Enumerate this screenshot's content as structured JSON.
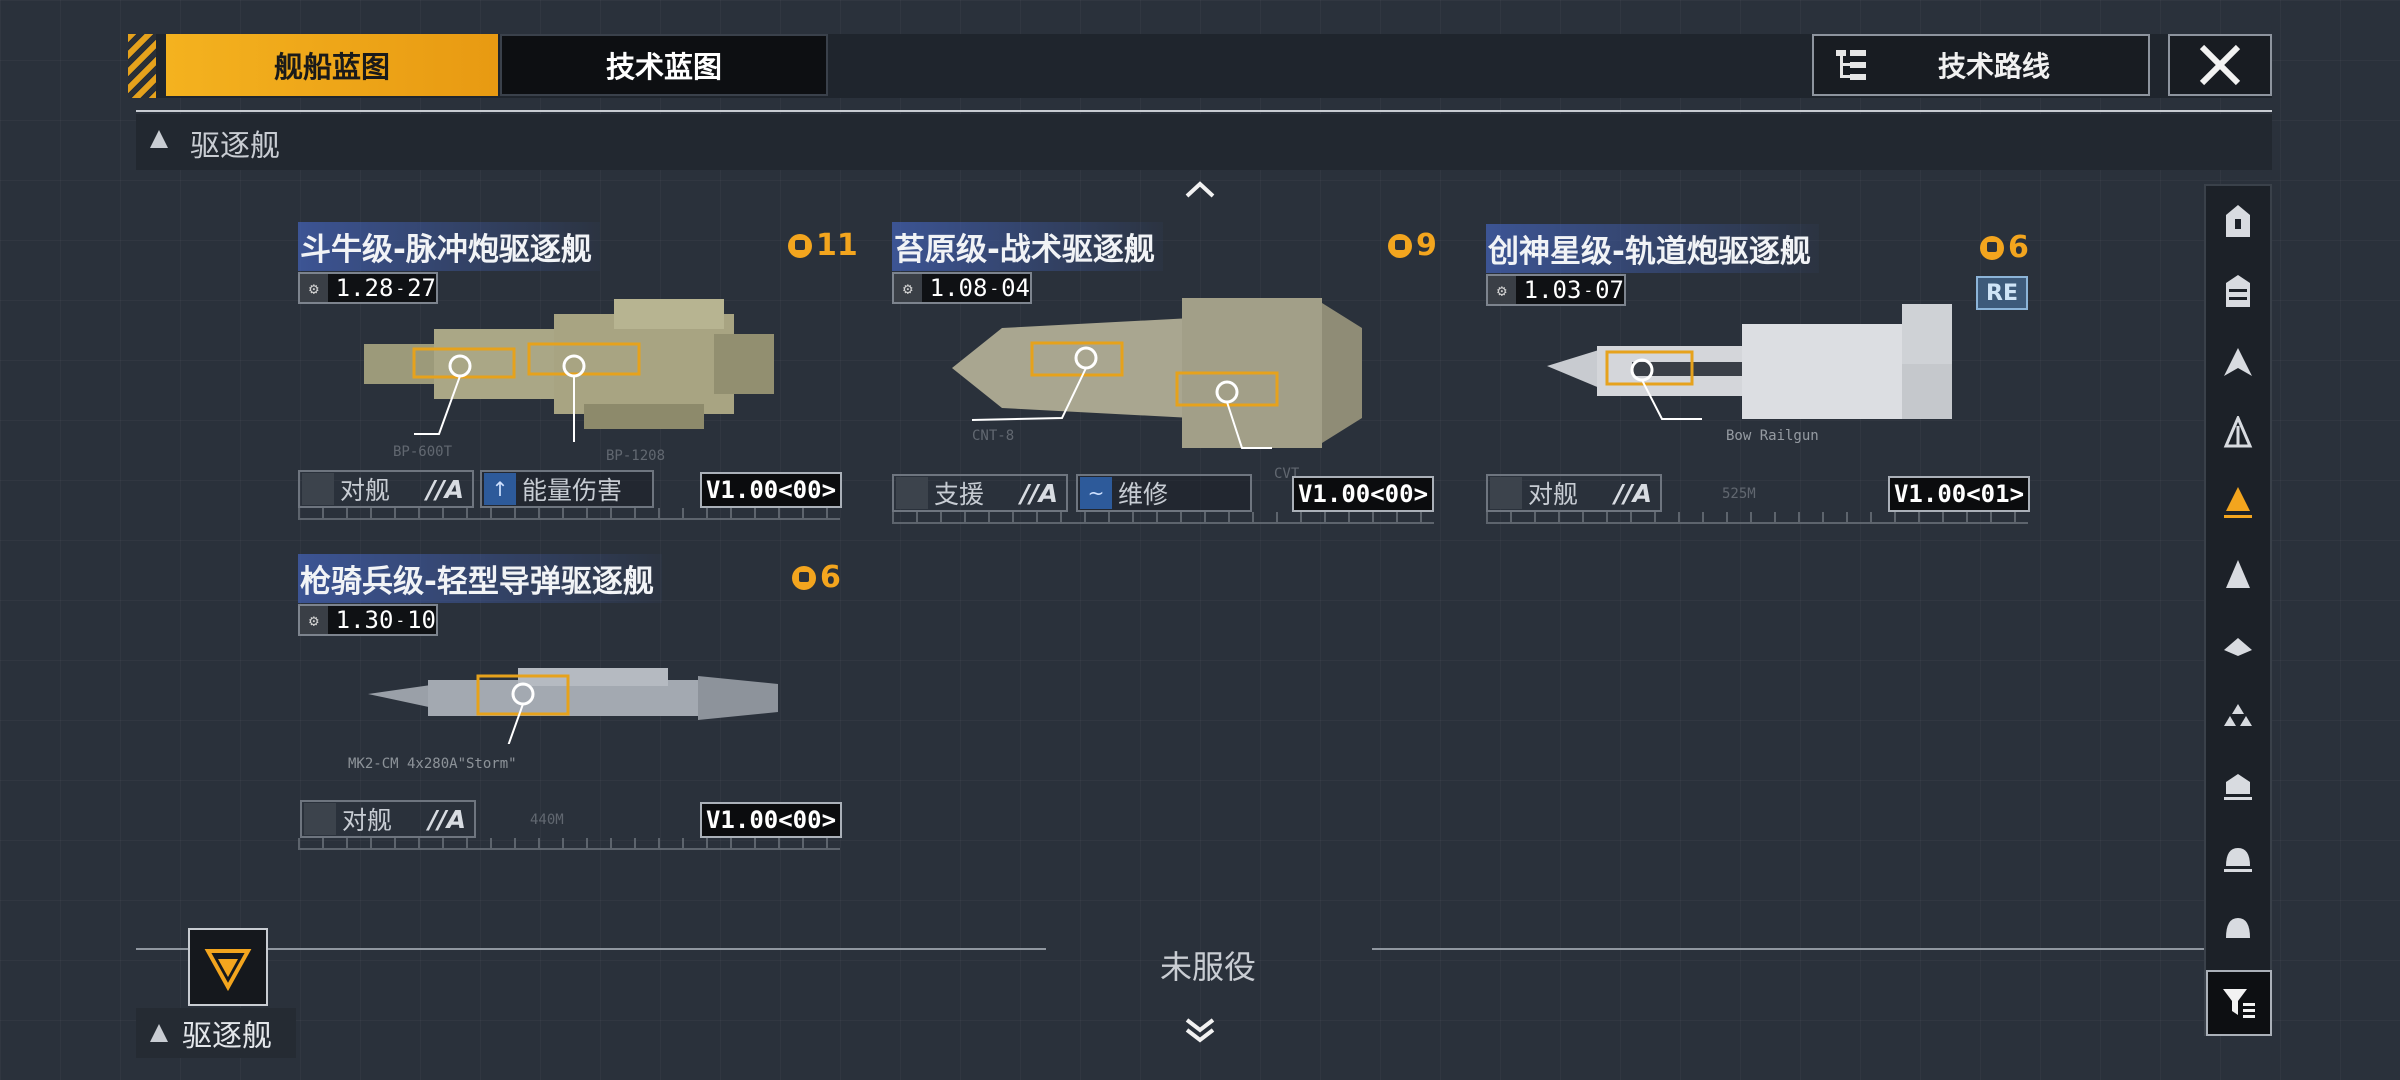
{
  "tabs": {
    "ship_blueprint": "舰船蓝图",
    "tech_blueprint": "技术蓝图"
  },
  "tech_route": "技术路线",
  "section": {
    "title": "驱逐舰"
  },
  "ships": [
    {
      "name": "斗牛级-脉冲炮驱逐舰",
      "count": "11",
      "version_main": "1.28",
      "version_sub": "27",
      "role": "对舰",
      "grade": "//A",
      "skill": "能量伤害",
      "tag": "V1.00<00>",
      "labels": [
        "BP-600T",
        "BP-1208"
      ]
    },
    {
      "name": "苔原级-战术驱逐舰",
      "count": "9",
      "version_main": "1.08",
      "version_sub": "04",
      "role": "支援",
      "grade": "//A",
      "skill": "维修",
      "tag": "V1.00<00>",
      "labels": [
        "CNT-8",
        "CVT"
      ]
    },
    {
      "name": "创神星级-轨道炮驱逐舰",
      "count": "6",
      "version_main": "1.03",
      "version_sub": "07",
      "role": "对舰",
      "grade": "//A",
      "badge": "RE",
      "tag": "V1.00<01>",
      "labels": [
        "Bow Railgun",
        "525M"
      ]
    },
    {
      "name": "枪骑兵级-轻型导弹驱逐舰",
      "count": "6",
      "version_main": "1.30",
      "version_sub": "10",
      "role": "对舰",
      "grade": "//A",
      "tag": "V1.00<00>",
      "labels": [
        "MK2-CM 4x280A\"Storm\"",
        "440M"
      ]
    }
  ],
  "bottom": {
    "status": "未服役",
    "category": "驱逐舰"
  },
  "sidebar_icons": [
    "carrier-icon",
    "battleship-icon",
    "cruiser-icon",
    "frigate-icon",
    "destroyer-icon",
    "corvette-icon",
    "aux-icon",
    "swarm-icon",
    "station-icon",
    "dock-icon",
    "base-icon"
  ],
  "colors": {
    "accent": "#f3a51e",
    "tab_active": "#f4b21f",
    "name_band": "#4260b2",
    "background": "#2a313b"
  }
}
